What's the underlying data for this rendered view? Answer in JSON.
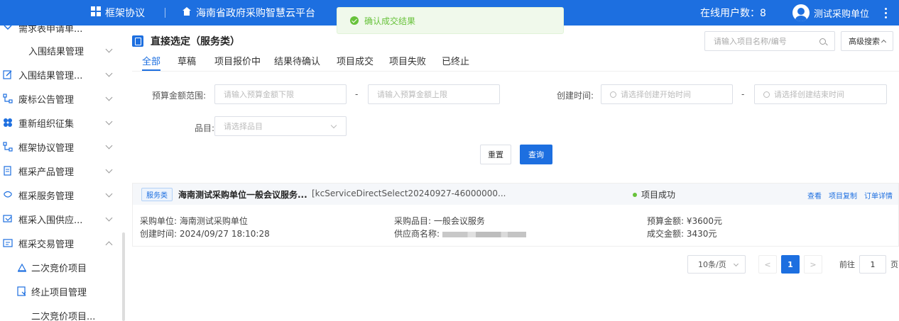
{
  "header": {
    "brand": "框架协议",
    "platform": "海南省政府采购智慧云平台",
    "online_users": "在线用户数：8",
    "user_name": "测试采购单位",
    "icons": [
      "grid-icon",
      "home-icon",
      "avatar-icon",
      "more-icon"
    ]
  },
  "toast": {
    "message": "确认成交结果",
    "color": "#67c23a"
  },
  "sidebar": {
    "items": [
      {
        "label": "需求表申请单...",
        "icon": "chevron-down-icon"
      },
      {
        "label": "入围结果管理",
        "icon": ""
      },
      {
        "label": "入围结果管理...",
        "icon": "edit-icon"
      },
      {
        "label": "废标公告管理",
        "icon": "flow-icon"
      },
      {
        "label": "重新组织征集",
        "icon": "cluster-icon"
      },
      {
        "label": "框架协议管理",
        "icon": "flow-icon"
      },
      {
        "label": "框采产品管理",
        "icon": "doc-icon"
      },
      {
        "label": "框采服务管理",
        "icon": "service-icon"
      },
      {
        "label": "框采入围供应...",
        "icon": "supplier-icon"
      },
      {
        "label": "框采交易管理",
        "icon": "trade-icon"
      },
      {
        "label": "二次竞价项目",
        "icon": "bid-icon"
      },
      {
        "label": "终止项目管理",
        "icon": "terminate-icon"
      },
      {
        "label": "二次竞价项目...",
        "icon": ""
      }
    ]
  },
  "page": {
    "title": "直接选定（服务类）",
    "search_placeholder": "请输入项目名称/编号",
    "advanced_search": "高级搜索",
    "tabs": [
      "全部",
      "草稿",
      "项目报价中",
      "结果待确认",
      "项目成交",
      "项目失败",
      "已终止"
    ],
    "active_tab": "全部"
  },
  "filters": {
    "budget_label": "预算金额范围:",
    "budget_min_placeholder": "请输入预算金额下限",
    "budget_max_placeholder": "请输入预算金额上限",
    "dash": "-",
    "create_time_label": "创建时间:",
    "create_start_placeholder": "请选择创建开始时间",
    "create_end_placeholder": "请选择创建结束时间",
    "category_label": "品目:",
    "category_placeholder": "请选择品目",
    "reset": "重置",
    "query": "查询"
  },
  "project": {
    "tag": "服务类",
    "name": "海南测试采购单位一般会议服务...",
    "code": "[kcServiceDirectSelect20240927-46000000...",
    "status": "项目成功",
    "actions": [
      "查看",
      "项目复制",
      "订单详情"
    ],
    "purchaser_label": "采购单位:",
    "purchaser": "海南测试采购单位",
    "create_time_label": "创建时间:",
    "create_time": "2024/09/27 18:10:28",
    "category_label": "采购品目:",
    "category": "一般会议服务",
    "supplier_label": "供应商名称:",
    "budget_label": "预算金额:",
    "budget": "¥3600元",
    "deal_label": "成交金额:",
    "deal": "3430元"
  },
  "pager": {
    "page_size": "10条/页",
    "current": "1",
    "goto_label": "前往",
    "goto_value": "1",
    "page_unit": "页"
  },
  "colors": {
    "primary": "#1d6fe0",
    "success": "#67c23a"
  }
}
